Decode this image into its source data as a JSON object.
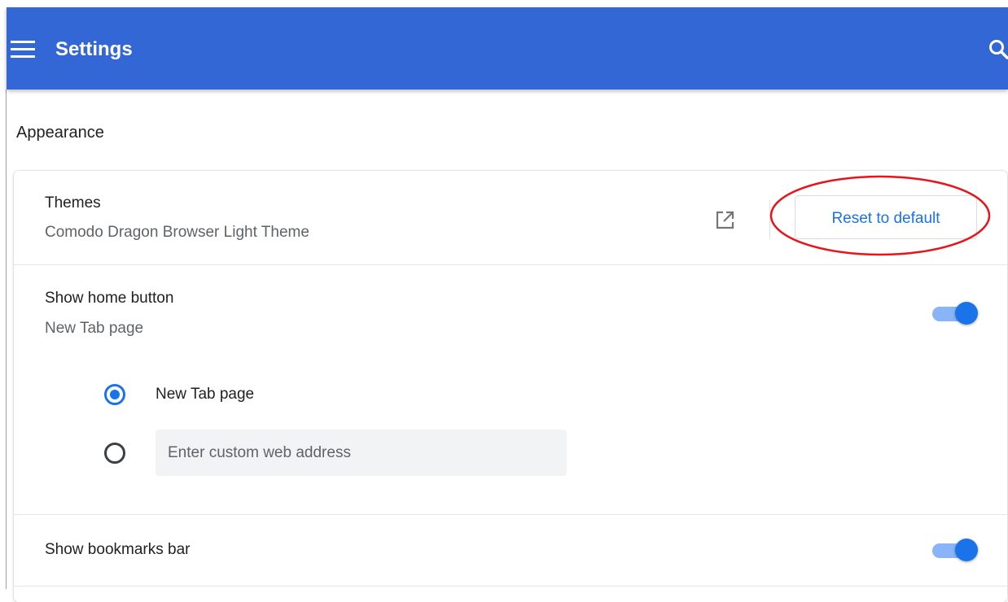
{
  "header": {
    "title": "Settings",
    "menu_icon": "menu-icon",
    "search_icon": "search-icon",
    "background_color": "#3367d6"
  },
  "appearance": {
    "section_title": "Appearance",
    "themes": {
      "label": "Themes",
      "value": "Comodo Dragon Browser Light Theme",
      "open_icon": "open-in-new-icon",
      "reset_button_label": "Reset to default"
    },
    "home_button": {
      "label": "Show home button",
      "sub_label": "New Tab page",
      "toggle_on": true,
      "options": [
        {
          "label": "New Tab page",
          "selected": true
        },
        {
          "placeholder": "Enter custom web address",
          "value": "",
          "selected": false
        }
      ]
    },
    "bookmarks_bar": {
      "label": "Show bookmarks bar",
      "toggle_on": true
    }
  },
  "colors": {
    "accent": "#1a73e8",
    "toggle_track": "#8ab4f8",
    "annotation_ring": "#e8141b"
  }
}
